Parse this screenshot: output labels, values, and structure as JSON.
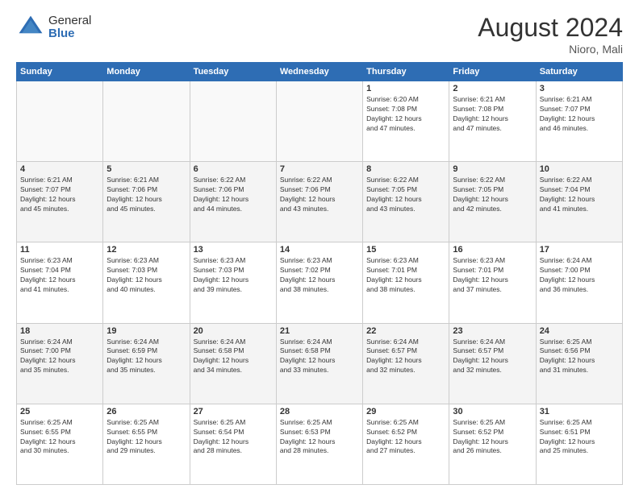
{
  "header": {
    "logo_general": "General",
    "logo_blue": "Blue",
    "month_year": "August 2024",
    "location": "Nioro, Mali"
  },
  "days_of_week": [
    "Sunday",
    "Monday",
    "Tuesday",
    "Wednesday",
    "Thursday",
    "Friday",
    "Saturday"
  ],
  "weeks": [
    [
      {
        "day": "",
        "info": ""
      },
      {
        "day": "",
        "info": ""
      },
      {
        "day": "",
        "info": ""
      },
      {
        "day": "",
        "info": ""
      },
      {
        "day": "1",
        "info": "Sunrise: 6:20 AM\nSunset: 7:08 PM\nDaylight: 12 hours\nand 47 minutes."
      },
      {
        "day": "2",
        "info": "Sunrise: 6:21 AM\nSunset: 7:08 PM\nDaylight: 12 hours\nand 47 minutes."
      },
      {
        "day": "3",
        "info": "Sunrise: 6:21 AM\nSunset: 7:07 PM\nDaylight: 12 hours\nand 46 minutes."
      }
    ],
    [
      {
        "day": "4",
        "info": "Sunrise: 6:21 AM\nSunset: 7:07 PM\nDaylight: 12 hours\nand 45 minutes."
      },
      {
        "day": "5",
        "info": "Sunrise: 6:21 AM\nSunset: 7:06 PM\nDaylight: 12 hours\nand 45 minutes."
      },
      {
        "day": "6",
        "info": "Sunrise: 6:22 AM\nSunset: 7:06 PM\nDaylight: 12 hours\nand 44 minutes."
      },
      {
        "day": "7",
        "info": "Sunrise: 6:22 AM\nSunset: 7:06 PM\nDaylight: 12 hours\nand 43 minutes."
      },
      {
        "day": "8",
        "info": "Sunrise: 6:22 AM\nSunset: 7:05 PM\nDaylight: 12 hours\nand 43 minutes."
      },
      {
        "day": "9",
        "info": "Sunrise: 6:22 AM\nSunset: 7:05 PM\nDaylight: 12 hours\nand 42 minutes."
      },
      {
        "day": "10",
        "info": "Sunrise: 6:22 AM\nSunset: 7:04 PM\nDaylight: 12 hours\nand 41 minutes."
      }
    ],
    [
      {
        "day": "11",
        "info": "Sunrise: 6:23 AM\nSunset: 7:04 PM\nDaylight: 12 hours\nand 41 minutes."
      },
      {
        "day": "12",
        "info": "Sunrise: 6:23 AM\nSunset: 7:03 PM\nDaylight: 12 hours\nand 40 minutes."
      },
      {
        "day": "13",
        "info": "Sunrise: 6:23 AM\nSunset: 7:03 PM\nDaylight: 12 hours\nand 39 minutes."
      },
      {
        "day": "14",
        "info": "Sunrise: 6:23 AM\nSunset: 7:02 PM\nDaylight: 12 hours\nand 38 minutes."
      },
      {
        "day": "15",
        "info": "Sunrise: 6:23 AM\nSunset: 7:01 PM\nDaylight: 12 hours\nand 38 minutes."
      },
      {
        "day": "16",
        "info": "Sunrise: 6:23 AM\nSunset: 7:01 PM\nDaylight: 12 hours\nand 37 minutes."
      },
      {
        "day": "17",
        "info": "Sunrise: 6:24 AM\nSunset: 7:00 PM\nDaylight: 12 hours\nand 36 minutes."
      }
    ],
    [
      {
        "day": "18",
        "info": "Sunrise: 6:24 AM\nSunset: 7:00 PM\nDaylight: 12 hours\nand 35 minutes."
      },
      {
        "day": "19",
        "info": "Sunrise: 6:24 AM\nSunset: 6:59 PM\nDaylight: 12 hours\nand 35 minutes."
      },
      {
        "day": "20",
        "info": "Sunrise: 6:24 AM\nSunset: 6:58 PM\nDaylight: 12 hours\nand 34 minutes."
      },
      {
        "day": "21",
        "info": "Sunrise: 6:24 AM\nSunset: 6:58 PM\nDaylight: 12 hours\nand 33 minutes."
      },
      {
        "day": "22",
        "info": "Sunrise: 6:24 AM\nSunset: 6:57 PM\nDaylight: 12 hours\nand 32 minutes."
      },
      {
        "day": "23",
        "info": "Sunrise: 6:24 AM\nSunset: 6:57 PM\nDaylight: 12 hours\nand 32 minutes."
      },
      {
        "day": "24",
        "info": "Sunrise: 6:25 AM\nSunset: 6:56 PM\nDaylight: 12 hours\nand 31 minutes."
      }
    ],
    [
      {
        "day": "25",
        "info": "Sunrise: 6:25 AM\nSunset: 6:55 PM\nDaylight: 12 hours\nand 30 minutes."
      },
      {
        "day": "26",
        "info": "Sunrise: 6:25 AM\nSunset: 6:55 PM\nDaylight: 12 hours\nand 29 minutes."
      },
      {
        "day": "27",
        "info": "Sunrise: 6:25 AM\nSunset: 6:54 PM\nDaylight: 12 hours\nand 28 minutes."
      },
      {
        "day": "28",
        "info": "Sunrise: 6:25 AM\nSunset: 6:53 PM\nDaylight: 12 hours\nand 28 minutes."
      },
      {
        "day": "29",
        "info": "Sunrise: 6:25 AM\nSunset: 6:52 PM\nDaylight: 12 hours\nand 27 minutes."
      },
      {
        "day": "30",
        "info": "Sunrise: 6:25 AM\nSunset: 6:52 PM\nDaylight: 12 hours\nand 26 minutes."
      },
      {
        "day": "31",
        "info": "Sunrise: 6:25 AM\nSunset: 6:51 PM\nDaylight: 12 hours\nand 25 minutes."
      }
    ]
  ]
}
